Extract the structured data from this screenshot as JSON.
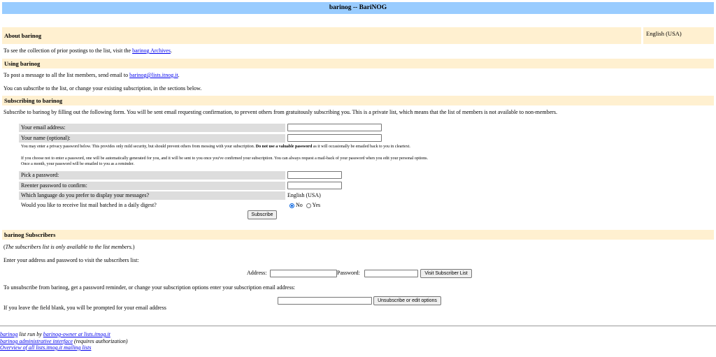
{
  "title": "barinog -- BariNOG",
  "about": {
    "heading": "About barinog",
    "language": "English (USA)",
    "archives_text_before": "To see the collection of prior postings to the list, visit the ",
    "archives_link": "barinog Archives",
    "archives_text_after": "."
  },
  "using": {
    "heading": "Using barinog",
    "post_text_before": "To post a message to all the list members, send email to ",
    "post_email": "barinog@lists.itnog.it",
    "post_text_after": ".",
    "subscribe_note": "You can subscribe to the list, or change your existing subscription, in the sections below."
  },
  "subscribing": {
    "heading": "Subscribing to barinog",
    "intro": "Subscribe to barinog by filling out the following form. You will be sent email requesting confirmation, to prevent others from gratuitously subscribing you. This is a private list, which means that the list of members is not available to non-members.",
    "email_label": "Your email address:",
    "name_label": "Your name (optional):",
    "privacy_note_before": "You may enter a privacy password below. This provides only mild security, but should prevent others from messing with your subscription. ",
    "privacy_note_bold": "Do not use a valuable password",
    "privacy_note_after": " as it will occasionally be emailed back to you in cleartext.",
    "auto_note_1": "If you choose not to enter a password, one will be automatically generated for you, and it will be sent to you once you've confirmed your subscription. You can always request a mail-back of your password when you edit your personal options.",
    "auto_note_2": "Once a month, your password will be emailed to you as a reminder.",
    "pick_label": "Pick a password:",
    "reenter_label": "Reenter password to confirm:",
    "lang_label": "Which language do you prefer to display your messages?",
    "lang_value": "English (USA)",
    "digest_label": "Would you like to receive list mail batched in a daily digest?",
    "digest_no": "No",
    "digest_yes": "Yes",
    "digest_selected": "No",
    "subscribe_button": "Subscribe"
  },
  "subscribers": {
    "heading": "barinog Subscribers",
    "only_members": "The subscribers list is only available to the list members.",
    "enter_prompt": "Enter your address and password to visit the subscribers list:",
    "address_label": "Address:",
    "password_label": "Password:",
    "visit_button": "Visit Subscriber List",
    "unsubscribe_prompt": "To unsubscribe from barinog, get a password reminder, or change your subscription options enter your subscription email address:",
    "unsubscribe_button": "Unsubscribe or edit options",
    "blank_note": "If you leave the field blank, you will be prompted for your email address"
  },
  "footer": {
    "list_link": "barinog",
    "run_by": " list run by ",
    "owner_link": "barinog-owner at lists.itnog.it",
    "admin_link": "barinog administrative interface",
    "admin_note": " (requires authorization)",
    "overview_link": "Overview of all lists.itnog.it mailing lists"
  }
}
